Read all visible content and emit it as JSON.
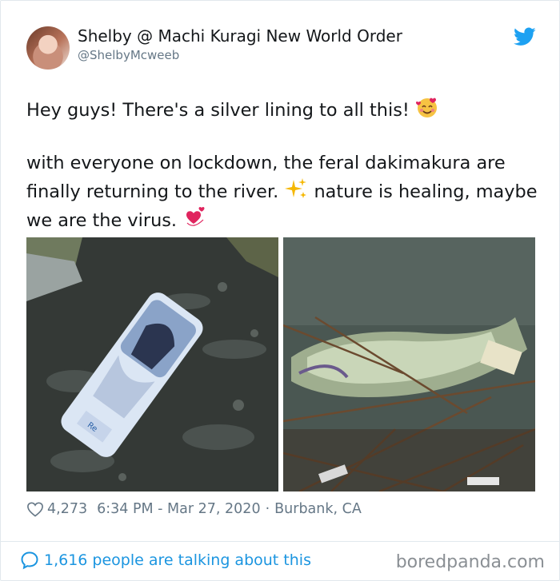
{
  "author": {
    "display_name": "Shelby @ Machi Kuragi New World Order",
    "handle": "@ShelbyMcweeb"
  },
  "tweet": {
    "line1": "Hey guys! There's a silver lining to all this!",
    "line2_part1": "with everyone on lockdown, the feral dakimakura are finally returning to the river.",
    "line2_part2": "nature is healing, maybe we are the virus."
  },
  "meta": {
    "likes": "4,273",
    "time": "6:34 PM - Mar 27, 2020",
    "separator": "·",
    "location": "Burbank, CA"
  },
  "conversation": {
    "label": "1,616 people are talking about this"
  },
  "watermark": "boredpanda.com",
  "colors": {
    "twitter_blue": "#1da1f2",
    "link_blue": "#1b95e0",
    "meta_gray": "#657786"
  },
  "icons": {
    "brand": "twitter-bird-icon",
    "like": "heart-icon",
    "conversation": "speech-bubble-icon",
    "emoji1": "smiling-face-with-hearts-emoji",
    "emoji2": "sparkles-emoji",
    "emoji3": "revolving-hearts-emoji"
  }
}
